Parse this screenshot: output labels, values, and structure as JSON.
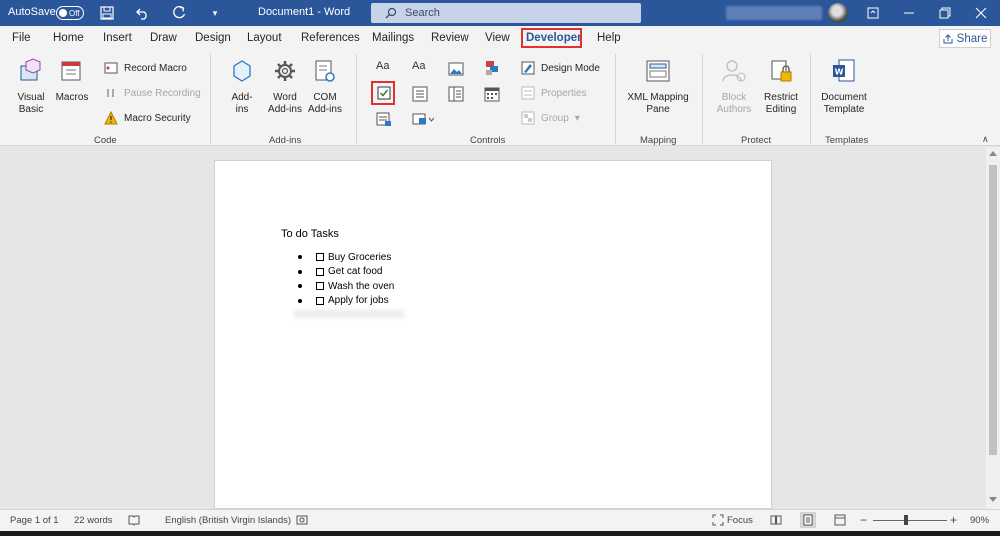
{
  "titlebar": {
    "autosave_label": "AutoSave",
    "autosave_state": "Off",
    "document_title": "Document1  -  Word",
    "search_placeholder": "Search"
  },
  "tabs": [
    {
      "label": "File"
    },
    {
      "label": "Home"
    },
    {
      "label": "Insert"
    },
    {
      "label": "Draw"
    },
    {
      "label": "Design"
    },
    {
      "label": "Layout"
    },
    {
      "label": "References"
    },
    {
      "label": "Mailings"
    },
    {
      "label": "Review"
    },
    {
      "label": "View"
    },
    {
      "label": "Developer"
    },
    {
      "label": "Help"
    }
  ],
  "share_label": "Share",
  "ribbon": {
    "code": {
      "label": "Code",
      "visual_basic": "Visual\nBasic",
      "macros": "Macros",
      "record_macro": "Record Macro",
      "pause_recording": "Pause Recording",
      "macro_security": "Macro Security"
    },
    "addins": {
      "label": "Add-ins",
      "addins": "Add-\nins",
      "word_addins": "Word\nAdd-ins",
      "com_addins": "COM\nAdd-ins"
    },
    "controls": {
      "label": "Controls",
      "design_mode": "Design Mode",
      "properties": "Properties",
      "group": "Group"
    },
    "mapping": {
      "label": "Mapping",
      "xml_mapping_pane": "XML Mapping\nPane"
    },
    "protect": {
      "label": "Protect",
      "block_authors": "Block\nAuthors",
      "restrict_editing": "Restrict\nEditing"
    },
    "templates": {
      "label": "Templates",
      "document_template": "Document\nTemplate"
    }
  },
  "document": {
    "heading": "To do Tasks",
    "items": [
      "Buy Groceries",
      "Get cat food",
      "Wash the oven",
      "Apply for jobs"
    ]
  },
  "statusbar": {
    "page": "Page 1 of 1",
    "words": "22 words",
    "language": "English (British Virgin Islands)",
    "focus": "Focus",
    "zoom_minus": "−",
    "zoom_plus": "+",
    "zoom": "90%",
    "zoom_level_fraction": 0.45
  },
  "colors": {
    "titlebar": "#2b579a",
    "highlight": "#e03030",
    "accent": "#2b579a"
  }
}
